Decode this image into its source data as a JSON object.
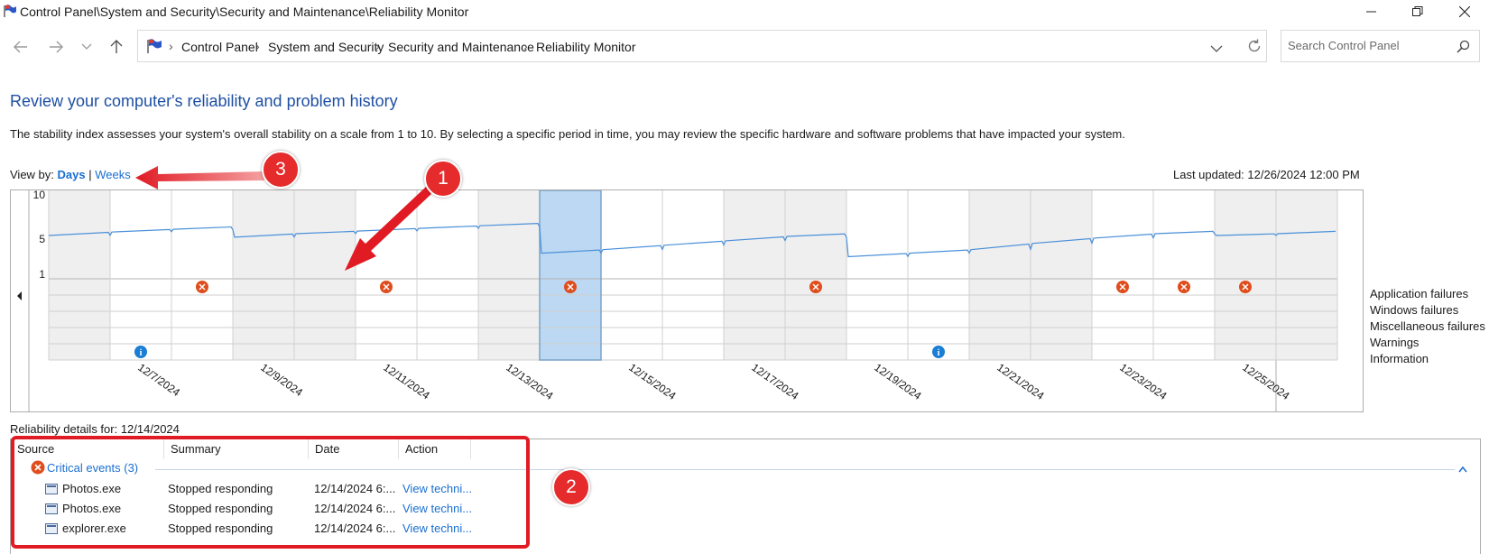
{
  "window": {
    "title": "Control Panel\\System and Security\\Security and Maintenance\\Reliability Monitor"
  },
  "nav": {
    "breadcrumbs": [
      "Control Panel",
      "System and Security",
      "Security and Maintenance",
      "Reliability Monitor"
    ],
    "search_placeholder": "Search Control Panel"
  },
  "page": {
    "heading": "Review your computer's reliability and problem history",
    "description": "The stability index assesses your system's overall stability on a scale from 1 to 10. By selecting a specific period in time, you may review the specific hardware and software problems that have impacted your system.",
    "view_by_label": "View by:",
    "view_days": "Days",
    "view_separator": "|",
    "view_weeks": "Weeks",
    "last_updated": "Last updated: 12/26/2024 12:00 PM"
  },
  "chart": {
    "y_ticks": [
      "10",
      "5",
      "1"
    ],
    "x_labels": [
      "12/7/2024",
      "12/9/2024",
      "12/11/2024",
      "12/13/2024",
      "12/15/2024",
      "12/17/2024",
      "12/19/2024",
      "12/21/2024",
      "12/23/2024",
      "12/25/2024"
    ],
    "selected_date": "12/14/2024",
    "legend": [
      "Application failures",
      "Windows failures",
      "Miscellaneous failures",
      "Warnings",
      "Information"
    ],
    "colors": {
      "line": "#4a90d9",
      "selected": "#bcd8f2",
      "error": "#e04d1c",
      "info": "#1a7fd4"
    }
  },
  "chart_data": {
    "type": "line",
    "x": [
      "12/6/2024",
      "12/7/2024",
      "12/8/2024",
      "12/9/2024",
      "12/10/2024",
      "12/11/2024",
      "12/12/2024",
      "12/13/2024",
      "12/14/2024",
      "12/15/2024",
      "12/16/2024",
      "12/17/2024",
      "12/18/2024",
      "12/19/2024",
      "12/20/2024",
      "12/21/2024",
      "12/22/2024",
      "12/23/2024",
      "12/24/2024",
      "12/25/2024",
      "12/26/2024"
    ],
    "series": [
      {
        "values": [
          5.4,
          5.8,
          6.1,
          5.2,
          5.6,
          5.9,
          6.2,
          6.5,
          3.4,
          3.8,
          4.3,
          4.8,
          5.3,
          3.0,
          3.4,
          3.8,
          4.5,
          5.1,
          5.6,
          5.4,
          5.6
        ]
      }
    ],
    "ylim": [
      1,
      10
    ],
    "application_failures": [
      "12/8/2024",
      "12/11/2024",
      "12/14/2024",
      "12/18/2024",
      "12/23/2024",
      "12/24/2024",
      "12/25/2024"
    ],
    "information": [
      "12/7/2024",
      "12/20/2024"
    ]
  },
  "details": {
    "label": "Reliability details for: 12/14/2024",
    "columns": [
      "Source",
      "Summary",
      "Date",
      "Action"
    ],
    "group_label": "Critical events (3)",
    "rows": [
      {
        "source": "Photos.exe",
        "summary": "Stopped responding",
        "date": "12/14/2024 6:...",
        "action": "View techni..."
      },
      {
        "source": "Photos.exe",
        "summary": "Stopped responding",
        "date": "12/14/2024 6:...",
        "action": "View techni..."
      },
      {
        "source": "explorer.exe",
        "summary": "Stopped responding",
        "date": "12/14/2024 6:...",
        "action": "View techni..."
      }
    ]
  },
  "annotations": {
    "badge1": "1",
    "badge2": "2",
    "badge3": "3"
  }
}
